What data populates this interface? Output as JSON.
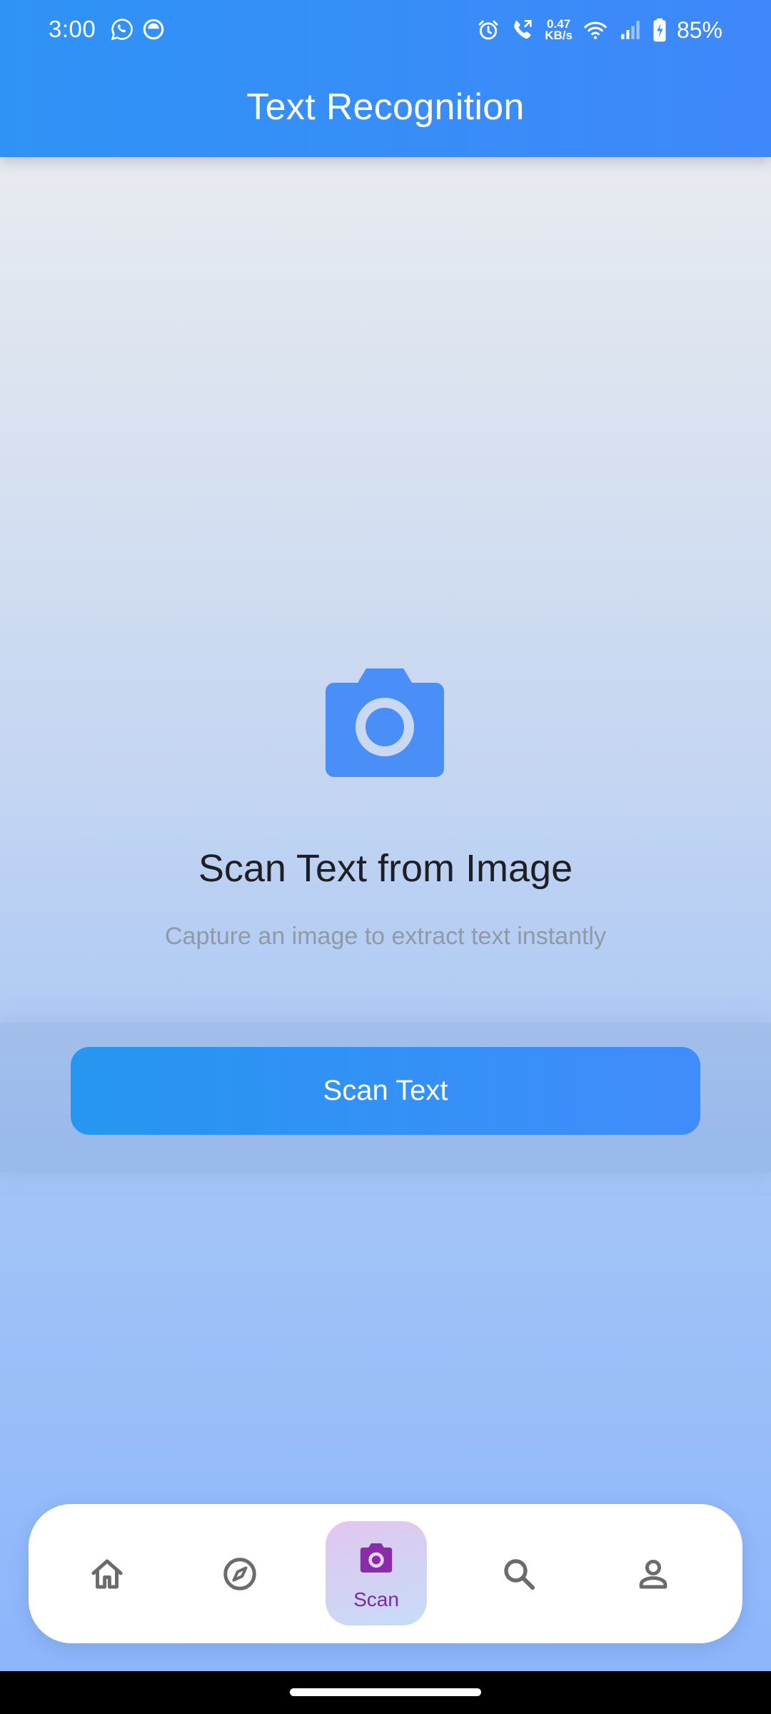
{
  "status_bar": {
    "time": "3:00",
    "notification_icons": [
      "whatsapp-icon",
      "app-notification-icon"
    ],
    "network_speed_value": "0.47",
    "network_speed_unit": "KB/s",
    "battery": "85%",
    "icons": [
      "alarm-icon",
      "call-icon",
      "wifi-icon",
      "signal-icon",
      "battery-charging-icon"
    ]
  },
  "header": {
    "title": "Text Recognition"
  },
  "main": {
    "hero_icon": "camera-icon",
    "hero_title": "Scan Text from Image",
    "hero_subtitle": "Capture an image to extract text instantly",
    "scan_button_label": "Scan Text"
  },
  "bottom_nav": {
    "items": [
      {
        "icon": "home-icon",
        "label": ""
      },
      {
        "icon": "compass-icon",
        "label": ""
      },
      {
        "icon": "camera-icon",
        "label": "Scan",
        "active": true
      },
      {
        "icon": "search-icon",
        "label": ""
      },
      {
        "icon": "person-icon",
        "label": ""
      }
    ]
  },
  "colors": {
    "header": "#3a8ef8",
    "accent": "#418cfb",
    "active_nav_label": "#7b2aa4",
    "icon_gray": "#6b6b6b"
  }
}
